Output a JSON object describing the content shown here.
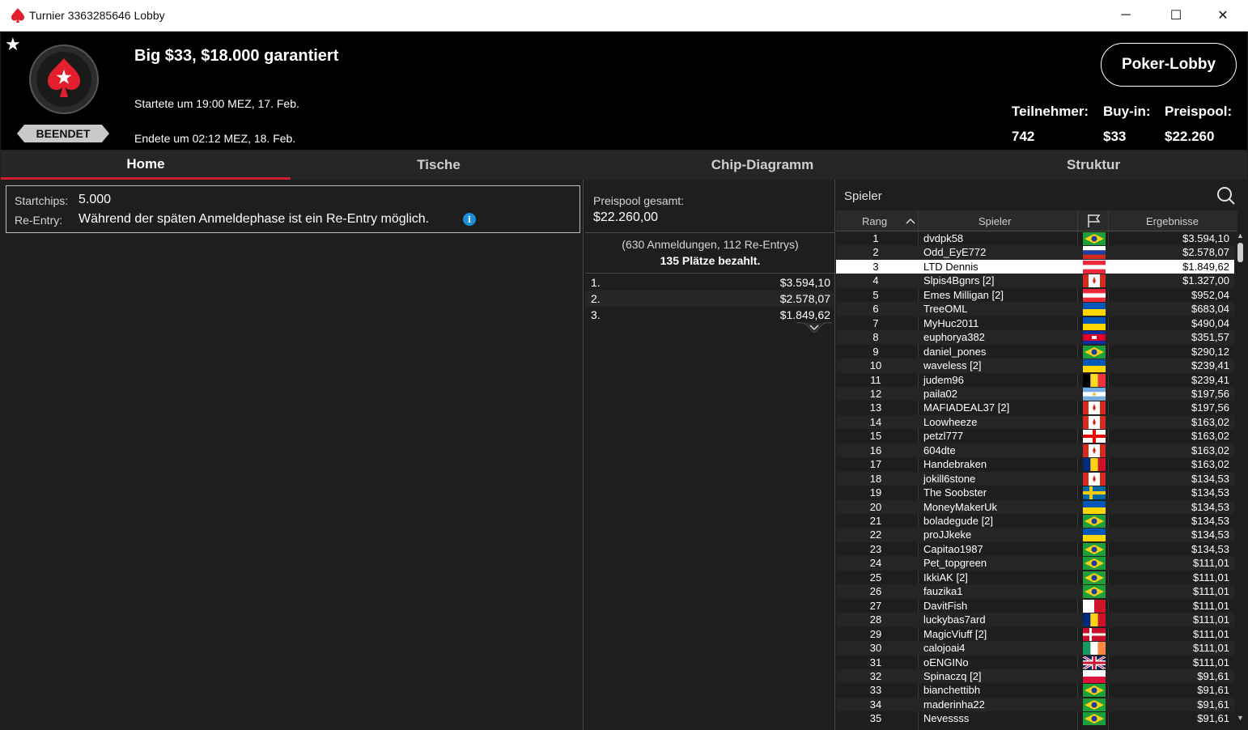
{
  "window": {
    "title": "Turnier 3363285646 Lobby",
    "minimize": "─",
    "maximize": "☐",
    "close": "✕"
  },
  "header": {
    "status": "BEENDET",
    "name": "Big $33, $18.000 garantiert",
    "started": "Startete um 19:00 MEZ, 17. Feb.",
    "ended": "Endete um 02:12 MEZ, 18. Feb.",
    "lobby_button": "Poker-Lobby",
    "stats": [
      {
        "label": "Teilnehmer:",
        "value": "742"
      },
      {
        "label": "Buy-in:",
        "value": "$33"
      },
      {
        "label": "Preispool:",
        "value": "$22.260"
      }
    ]
  },
  "tabs": [
    "Home",
    "Tische",
    "Chip-Diagramm",
    "Struktur"
  ],
  "info": {
    "startchips_label": "Startchips:",
    "startchips_value": "5.000",
    "reentry_label": "Re-Entry:",
    "reentry_value": "Während der späten Anmeldephase ist ein Re-Entry möglich.",
    "info_icon": "i"
  },
  "prizepool": {
    "label": "Preispool gesamt:",
    "value": "$22.260,00",
    "entries": "(630 Anmeldungen, 112 Re-Entrys)",
    "paid": "135 Plätze bezahlt.",
    "places": [
      {
        "place": "1.",
        "amount": "$3.594,10"
      },
      {
        "place": "2.",
        "amount": "$2.578,07"
      },
      {
        "place": "3.",
        "amount": "$1.849,62"
      }
    ]
  },
  "players": {
    "search_label": "Spieler",
    "columns": {
      "rank": "Rang",
      "player": "Spieler",
      "results": "Ergebnisse"
    },
    "selected_rank": 3,
    "rows": [
      {
        "rank": "1",
        "name": "dvdpk58",
        "flag": "br",
        "amount": "$3.594,10"
      },
      {
        "rank": "2",
        "name": "Odd_EyE772",
        "flag": "ru",
        "amount": "$2.578,07"
      },
      {
        "rank": "3",
        "name": "LTD Dennis",
        "flag": "at",
        "amount": "$1.849,62"
      },
      {
        "rank": "4",
        "name": "Slpis4Bgnrs [2]",
        "flag": "ca",
        "amount": "$1.327,00"
      },
      {
        "rank": "5",
        "name": "Emes Milligan [2]",
        "flag": "at",
        "amount": "$952,04"
      },
      {
        "rank": "6",
        "name": "TreeOML",
        "flag": "ua",
        "amount": "$683,04"
      },
      {
        "rank": "7",
        "name": "MyHuc2011",
        "flag": "ua",
        "amount": "$490,04"
      },
      {
        "rank": "8",
        "name": "euphorya382",
        "flag": "kh",
        "amount": "$351,57"
      },
      {
        "rank": "9",
        "name": "daniel_pones",
        "flag": "br",
        "amount": "$290,12"
      },
      {
        "rank": "10",
        "name": "waveless [2]",
        "flag": "ua",
        "amount": "$239,41"
      },
      {
        "rank": "11",
        "name": "judem96",
        "flag": "be",
        "amount": "$239,41"
      },
      {
        "rank": "12",
        "name": "paila02",
        "flag": "ar",
        "amount": "$197,56"
      },
      {
        "rank": "13",
        "name": "MAFIADEAL37 [2]",
        "flag": "ca",
        "amount": "$197,56"
      },
      {
        "rank": "14",
        "name": "Loowheeze",
        "flag": "ca",
        "amount": "$163,02"
      },
      {
        "rank": "15",
        "name": "petzl777",
        "flag": "ge",
        "amount": "$163,02"
      },
      {
        "rank": "16",
        "name": "604dte",
        "flag": "ca",
        "amount": "$163,02"
      },
      {
        "rank": "17",
        "name": "Handebraken",
        "flag": "ro",
        "amount": "$163,02"
      },
      {
        "rank": "18",
        "name": "jokill6stone",
        "flag": "ca",
        "amount": "$134,53"
      },
      {
        "rank": "19",
        "name": "The Soobster",
        "flag": "se",
        "amount": "$134,53"
      },
      {
        "rank": "20",
        "name": "MoneyMakerUk",
        "flag": "ua",
        "amount": "$134,53"
      },
      {
        "rank": "21",
        "name": "boladegude [2]",
        "flag": "br",
        "amount": "$134,53"
      },
      {
        "rank": "22",
        "name": "proJJkeke",
        "flag": "ua",
        "amount": "$134,53"
      },
      {
        "rank": "23",
        "name": "Capitao1987",
        "flag": "br",
        "amount": "$134,53"
      },
      {
        "rank": "24",
        "name": "Pet_topgreen",
        "flag": "br",
        "amount": "$111,01"
      },
      {
        "rank": "25",
        "name": "IkkiAK [2]",
        "flag": "br",
        "amount": "$111,01"
      },
      {
        "rank": "26",
        "name": "fauzika1",
        "flag": "br",
        "amount": "$111,01"
      },
      {
        "rank": "27",
        "name": "DavitFish",
        "flag": "mt",
        "amount": "$111,01"
      },
      {
        "rank": "28",
        "name": "luckybas7ard",
        "flag": "ro",
        "amount": "$111,01"
      },
      {
        "rank": "29",
        "name": "MagicViuff [2]",
        "flag": "dk",
        "amount": "$111,01"
      },
      {
        "rank": "30",
        "name": "calojoai4",
        "flag": "ie",
        "amount": "$111,01"
      },
      {
        "rank": "31",
        "name": "oENGINo",
        "flag": "gb",
        "amount": "$111,01"
      },
      {
        "rank": "32",
        "name": "Spinaczq [2]",
        "flag": "pl",
        "amount": "$91,61"
      },
      {
        "rank": "33",
        "name": "bianchettibh",
        "flag": "br",
        "amount": "$91,61"
      },
      {
        "rank": "34",
        "name": "maderinha22",
        "flag": "br",
        "amount": "$91,61"
      },
      {
        "rank": "35",
        "name": "Nevessss",
        "flag": "br",
        "amount": "$91,61"
      }
    ]
  },
  "colors": {
    "accent": "#d01f2f",
    "header_bg": "#000000",
    "panel_bg": "#1e1e1e",
    "selected_row": "#ffffff"
  }
}
